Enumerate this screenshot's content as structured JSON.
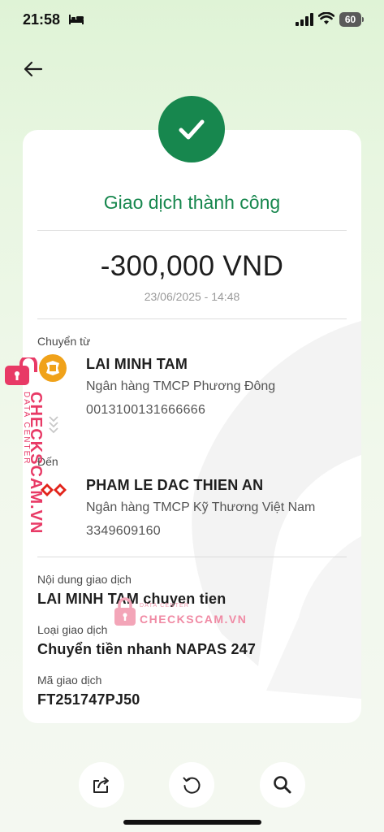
{
  "status_bar": {
    "time": "21:58",
    "battery": "60"
  },
  "transaction": {
    "status_title": "Giao dịch thành công",
    "amount": "-300,000 VND",
    "datetime": "23/06/2025 - 14:48"
  },
  "sender": {
    "label": "Chuyển từ",
    "name": "LAI MINH TAM",
    "bank": "Ngân hàng TMCP Phương Đông",
    "account": "0013100131666666"
  },
  "recipient": {
    "label": "Đến",
    "name": "PHAM LE DAC THIEN AN",
    "bank": "Ngân hàng TMCP Kỹ Thương Việt Nam",
    "account": "3349609160"
  },
  "details": {
    "content_label": "Nội dung giao dịch",
    "content_value": "LAI MINH TAM chuyen tien",
    "type_label": "Loại giao dịch",
    "type_value": "Chuyển tiền nhanh NAPAS 247",
    "code_label": "Mã giao dịch",
    "code_value": "FT251747PJ50"
  },
  "watermark": {
    "brand": "CHECKSCAM.VN",
    "sub": "DATA CENTER"
  },
  "actions": [
    "share-icon",
    "repeat-icon",
    "search-icon"
  ],
  "colors": {
    "success_green": "#17874e",
    "watermark_pink": "#e83a66",
    "ocb_orange": "#f0a21a",
    "techcombank_red": "#e2231a"
  }
}
